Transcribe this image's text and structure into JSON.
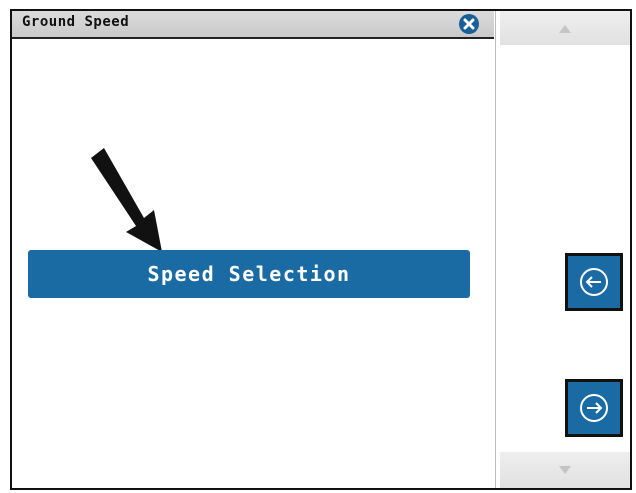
{
  "window": {
    "title": "Ground Speed"
  },
  "main": {
    "speed_selection_label": "Speed Selection"
  },
  "icons": {
    "close": "close-circle-icon",
    "pointer": "pointer-arrow-icon",
    "scroll_up": "triangle-up-icon",
    "scroll_down": "triangle-down-icon",
    "previous": "arrow-left-circle-icon",
    "next": "arrow-right-circle-icon"
  },
  "colors": {
    "accent": "#1a6aa4",
    "close_button": "#1a5f96",
    "title_bar": "#d3d3d3",
    "border": "#111111"
  }
}
